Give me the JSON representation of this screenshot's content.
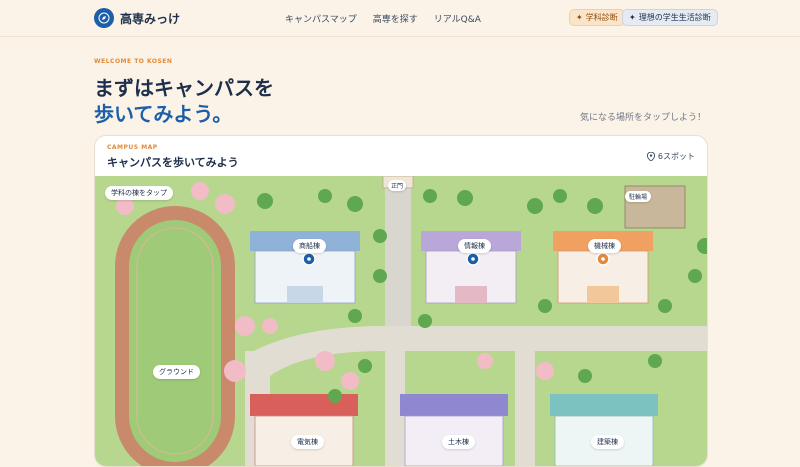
{
  "header": {
    "logo_text": "高専みっけ",
    "nav": [
      "キャンパスマップ",
      "高専を探す",
      "リアルQ&A"
    ],
    "pill_a": "学科診断",
    "pill_b": "理想の学生生活診断"
  },
  "hero": {
    "eyebrow": "WELCOME TO KOSEN",
    "line1": "まずはキャンパスを",
    "line2": "歩いてみよう。",
    "hint": "気になる場所をタップしよう！"
  },
  "card": {
    "eyebrow": "CAMPUS MAP",
    "title": "キャンパスを歩いてみよう",
    "spots": "6スポット"
  },
  "map": {
    "tap_hint": "学科の棟をタップ",
    "gate": "正門",
    "bicycle": "駐輪場",
    "ground": "グラウンド",
    "buildings": [
      "商船棟",
      "情報棟",
      "機械棟",
      "電気棟",
      "土木棟",
      "建築棟"
    ]
  },
  "colors": {
    "accent_blue": "#1c5fa8",
    "accent_orange": "#e08a3a",
    "grass": "#a7cf7f",
    "path": "#d9d6cf"
  }
}
